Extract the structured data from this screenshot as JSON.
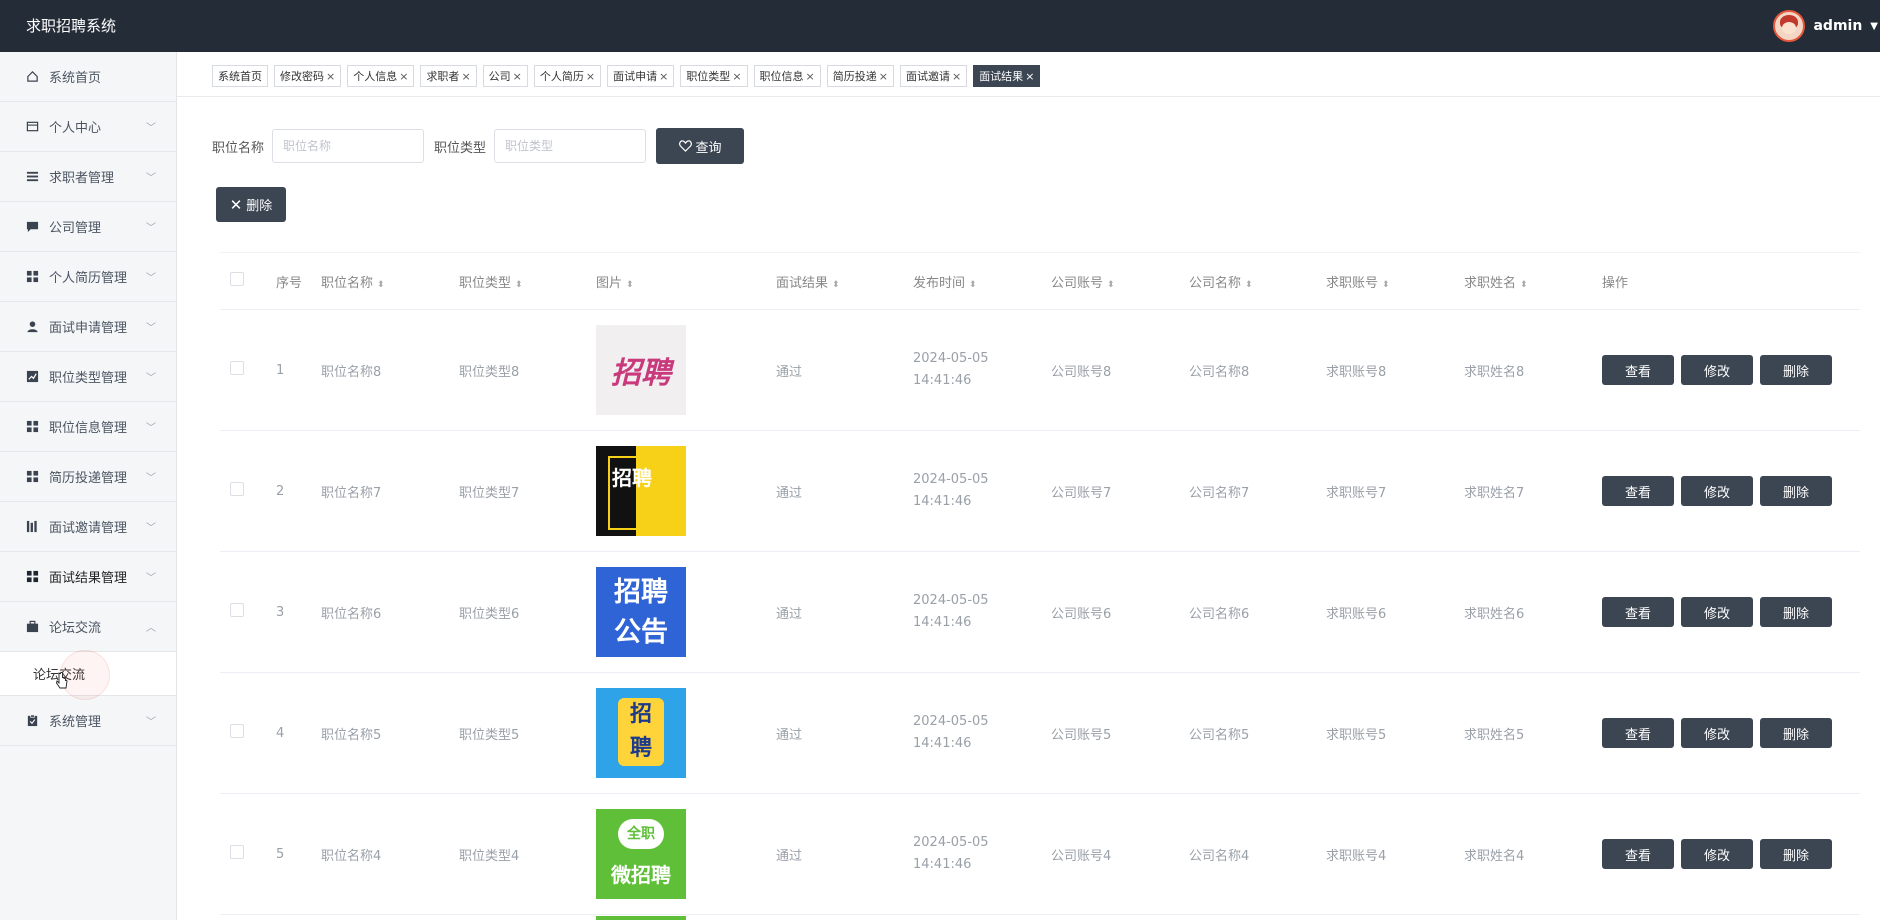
{
  "app": {
    "title": "求职招聘系统",
    "username": "admin"
  },
  "sidebar": {
    "items": [
      {
        "label": "系统首页",
        "icon": "home-icon"
      },
      {
        "label": "个人中心",
        "icon": "id-card-icon"
      },
      {
        "label": "求职者管理",
        "icon": "list-icon"
      },
      {
        "label": "公司管理",
        "icon": "chat-icon"
      },
      {
        "label": "个人简历管理",
        "icon": "grid-icon"
      },
      {
        "label": "面试申请管理",
        "icon": "user-icon"
      },
      {
        "label": "职位类型管理",
        "icon": "chart-icon"
      },
      {
        "label": "职位信息管理",
        "icon": "grid-icon"
      },
      {
        "label": "简历投递管理",
        "icon": "grid-icon"
      },
      {
        "label": "面试邀请管理",
        "icon": "bars-icon"
      },
      {
        "label": "面试结果管理",
        "icon": "grid-icon"
      },
      {
        "label": "论坛交流",
        "icon": "briefcase-icon"
      },
      {
        "label": "系统管理",
        "icon": "clipboard-icon"
      }
    ],
    "submenu_label": "论坛交流"
  },
  "tabs": [
    "系统首页",
    "修改密码",
    "个人信息",
    "求职者",
    "公司",
    "个人简历",
    "面试申请",
    "职位类型",
    "职位信息",
    "简历投递",
    "面试邀请",
    "面试结果"
  ],
  "tab_close": "×",
  "search": {
    "label1": "职位名称",
    "placeholder1": "职位名称",
    "label2": "职位类型",
    "placeholder2": "职位类型",
    "query_label": "查询"
  },
  "delete_label": "删除",
  "table": {
    "headers": [
      "序号",
      "职位名称",
      "职位类型",
      "图片",
      "面试结果",
      "发布时间",
      "公司账号",
      "公司名称",
      "求职账号",
      "求职姓名",
      "操作"
    ],
    "rows": [
      {
        "no": "1",
        "name": "职位名称8",
        "type": "职位类型8",
        "result": "通过",
        "time": "2024-05-05 14:41:46",
        "company_acct": "公司账号8",
        "company_name": "公司名称8",
        "seeker_acct": "求职账号8",
        "seeker_name": "求职姓名8"
      },
      {
        "no": "2",
        "name": "职位名称7",
        "type": "职位类型7",
        "result": "通过",
        "time": "2024-05-05 14:41:46",
        "company_acct": "公司账号7",
        "company_name": "公司名称7",
        "seeker_acct": "求职账号7",
        "seeker_name": "求职姓名7"
      },
      {
        "no": "3",
        "name": "职位名称6",
        "type": "职位类型6",
        "result": "通过",
        "time": "2024-05-05 14:41:46",
        "company_acct": "公司账号6",
        "company_name": "公司名称6",
        "seeker_acct": "求职账号6",
        "seeker_name": "求职姓名6"
      },
      {
        "no": "4",
        "name": "职位名称5",
        "type": "职位类型5",
        "result": "通过",
        "time": "2024-05-05 14:41:46",
        "company_acct": "公司账号5",
        "company_name": "公司名称5",
        "seeker_acct": "求职账号5",
        "seeker_name": "求职姓名5"
      },
      {
        "no": "5",
        "name": "职位名称4",
        "type": "职位类型4",
        "result": "通过",
        "time": "2024-05-05 14:41:46",
        "company_acct": "公司账号4",
        "company_name": "公司名称4",
        "seeker_acct": "求职账号4",
        "seeker_name": "求职姓名4"
      }
    ],
    "actions": {
      "view": "查看",
      "edit": "修改",
      "delete": "删除"
    }
  },
  "thumb_text": {
    "t1": "招聘",
    "t2": "招聘",
    "t3a": "招聘",
    "t3b": "公告",
    "t4a": "招",
    "t4b": "聘",
    "t5a": "全职",
    "t5b": "微招聘"
  },
  "colors": {
    "header_bg": "#242c37",
    "button_bg": "#3c4552",
    "sidebar_bg": "#f5f6f7"
  }
}
